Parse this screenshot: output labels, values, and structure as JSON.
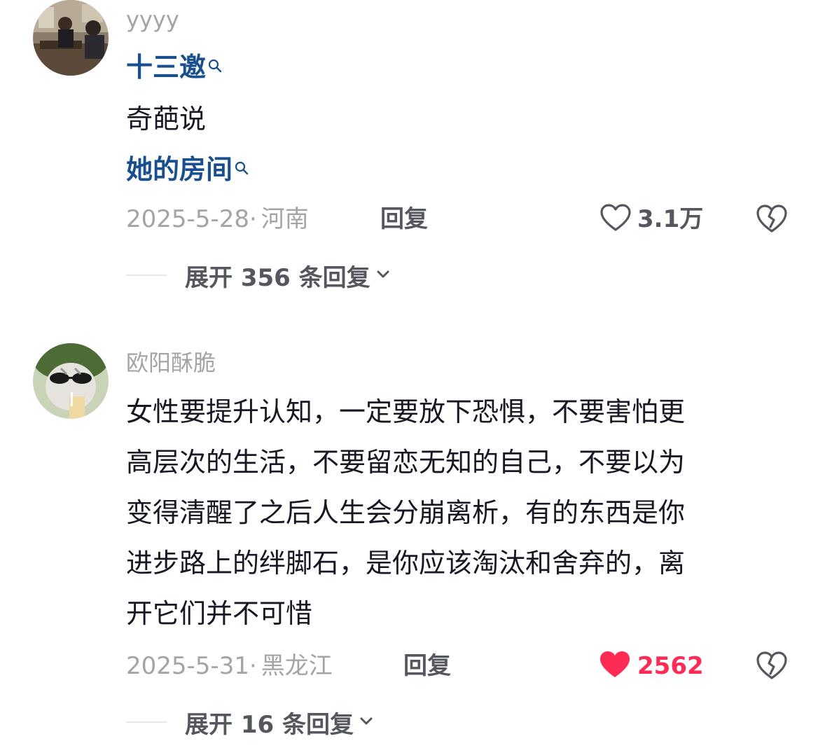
{
  "comments": [
    {
      "username": "yyyy",
      "link1": "十三邀",
      "text": "奇葩说",
      "link2": "她的房间",
      "date": "2025-5-28",
      "sep": "·",
      "location": "河南",
      "reply_label": "回复",
      "like_count": "3.1万",
      "liked": false,
      "expand_label": "展开 356 条回复"
    },
    {
      "username": "欧阳酥脆",
      "lines": [
        "女性要提升认知，一定要放下恐惧，不要害怕更",
        "高层次的生活，不要留恋无知的自己，不要以为",
        "变得清醒了之后人生会分崩离析，有的东西是你",
        "进步路上的绊脚石，是你应该淘汰和舍弃的，离",
        "开它们并不可惜"
      ],
      "date": "2025-5-31",
      "sep": "·",
      "location": "黑龙江",
      "reply_label": "回复",
      "like_count": "2562",
      "liked": true,
      "expand_label": "展开 16 条回复"
    }
  ],
  "icons": {
    "like": "heart-icon",
    "dislike": "broken-heart-icon",
    "search": "search-icon",
    "expand": "chevron-down-icon"
  },
  "colors": {
    "like_active": "#fe2c55",
    "link": "#1a4f8f",
    "muted": "#a3a4a8"
  }
}
